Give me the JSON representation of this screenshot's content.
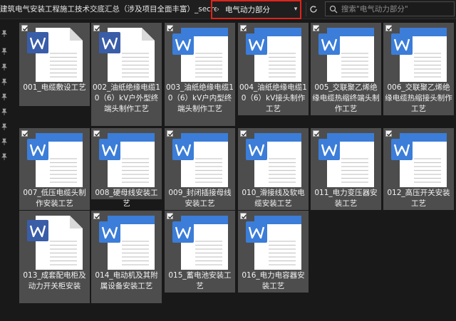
{
  "address_bar": {
    "path": "建筑电气安装工程施工技术交底汇总（涉及项目全面丰富）_secret",
    "separator": "›",
    "current_folder": "电气动力部分",
    "dropdown_icon": "chevron-down-icon",
    "refresh_icon": "refresh-icon"
  },
  "search": {
    "placeholder": "搜索\"电气动力部分\"",
    "icon": "search-icon"
  },
  "colors": {
    "background": "#191919",
    "tile_bg": "#4d4d4d",
    "highlight_border": "#e2231a",
    "word_blue": "#3b7dd8",
    "word_dark": "#3a5da8"
  },
  "files": [
    {
      "name": "001_电缆敷设工艺",
      "style": "dark",
      "checked": true
    },
    {
      "name": "002_油纸绝缘电缆10（6）kV户外型终端头制作工艺",
      "style": "dark",
      "checked": true
    },
    {
      "name": "003_油纸绝缘电缆10（6）kV户内型终端头制作工艺",
      "style": "blue",
      "checked": true
    },
    {
      "name": "004_油纸绝缘电缆10（6）kV接头制作工艺",
      "style": "blue",
      "checked": true
    },
    {
      "name": "005_交联聚乙烯绝缘电缆热缩终端头制作工艺",
      "style": "blue",
      "checked": true
    },
    {
      "name": "006_交联聚乙烯绝缘电缆热缩接头制作工艺",
      "style": "blue",
      "checked": true
    },
    {
      "name": "007_低压电缆头制作安装工艺",
      "style": "blue",
      "checked": true
    },
    {
      "name": "008_硬母线安装工艺",
      "style": "blue",
      "checked": true
    },
    {
      "name": "009_封闭插接母线安装工艺",
      "style": "blue",
      "checked": true
    },
    {
      "name": "010_滑接线及软电缆安装工艺",
      "style": "blue",
      "checked": true
    },
    {
      "name": "011_电力变压器安装工艺",
      "style": "blue",
      "checked": true
    },
    {
      "name": "012_高压开关安装工艺",
      "style": "blue",
      "checked": true
    },
    {
      "name": "013_成套配电柜及动力开关柜安装",
      "style": "dark",
      "checked": false
    },
    {
      "name": "014_电动机及其附属设备安装工艺",
      "style": "blue",
      "checked": true
    },
    {
      "name": "015_蓄电池安装工艺",
      "style": "blue",
      "checked": true
    },
    {
      "name": "016_电力电容器安装工艺",
      "style": "blue",
      "checked": true
    }
  ]
}
